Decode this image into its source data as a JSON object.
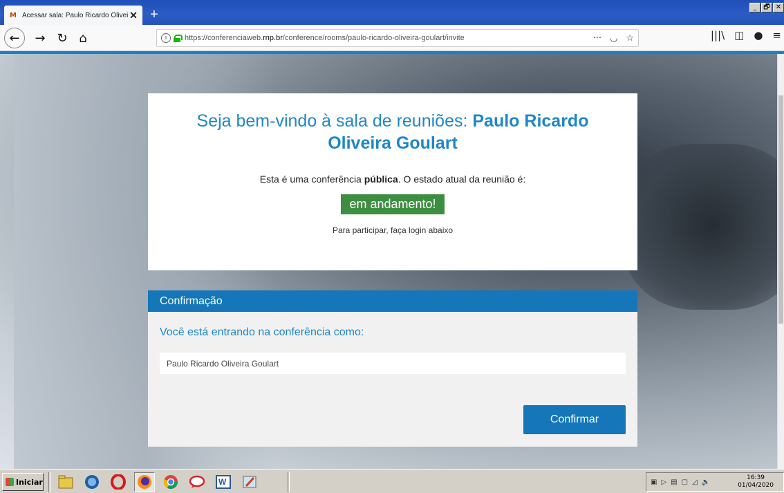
{
  "browser": {
    "tab_title": "Acessar sala: Paulo Ricardo Oliveir",
    "tab_close": "✕",
    "new_tab": "+",
    "url_prefix": "https://conferenciaweb.",
    "url_domain": "rnp.br",
    "url_path": "/conference/rooms/paulo-ricardo-oliveira-goulart/invite",
    "window_buttons": [
      "_",
      "🗗",
      "✕"
    ]
  },
  "page": {
    "welcome_prefix": "Seja bem-vindo à sala de reuniões: ",
    "room_name": "Paulo Ricardo Oliveira Goulart",
    "state_prefix": "Esta é uma conferência ",
    "state_public": "pública",
    "state_suffix": ". O estado atual da reunião é:",
    "status": "em andamento!",
    "login_hint": "Para participar, faça login abaixo",
    "confirm_header": "Confirmação",
    "joining_label": "Você está entrando na conferência como:",
    "name_value": "Paulo Ricardo Oliveira Goulart",
    "confirm_button": "Confirmar"
  },
  "taskbar": {
    "start_label": "Iniciar",
    "time": "16:39",
    "date": "01/04/2020"
  },
  "colors": {
    "accent_blue": "#1f87c6",
    "panel_blue": "#1576b9",
    "status_green": "#3e8e41"
  }
}
